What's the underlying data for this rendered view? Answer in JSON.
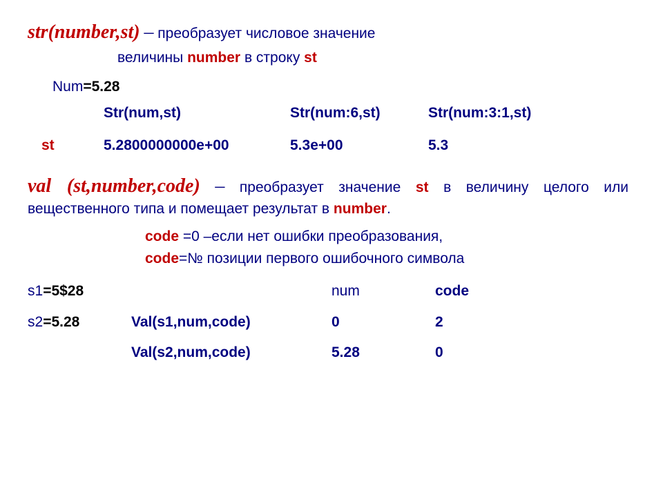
{
  "str_section": {
    "func": "str(number,st)",
    "dash": "–",
    "desc_part1": "преобразует числовое значение",
    "desc_line2_a": "величины ",
    "desc_line2_number": "number",
    "desc_line2_b": " в строку ",
    "desc_line2_st": "st",
    "num_label": "Num",
    "num_eq": "=",
    "num_val": "5.28",
    "st_label": "st",
    "cols": [
      "Str(num,st)",
      "Str(num:6,st)",
      "Str(num:3:1,st)"
    ],
    "vals": [
      "5.2800000000e+00",
      "5.3e+00",
      "5.3"
    ]
  },
  "val_section": {
    "func": "val (st,number,code)",
    "dash": "–",
    "desc_a": "преобразует значение ",
    "desc_st": "st",
    "desc_b": " в величину целого или вещественного типа и помещает результат в ",
    "desc_number": "number",
    "desc_dot": ".",
    "code_label": "сode",
    "code1a": " =0 –если нет ошибки преобразования,",
    "code2a": "=№ позиции первого ошибочного символа",
    "s1_label": "s1",
    "s1_eq": "=",
    "s1_val": "5$28",
    "s2_label": "s2",
    "s2_eq": "=",
    "s2_val": "5.28",
    "num_hdr": "num",
    "code_hdr": "code",
    "call1": "Val(s1,num,code)",
    "call2": "Val(s2,num,code)",
    "r1_num": "0",
    "r1_code": "2",
    "r2_num": "5.28",
    "r2_code": "0"
  }
}
